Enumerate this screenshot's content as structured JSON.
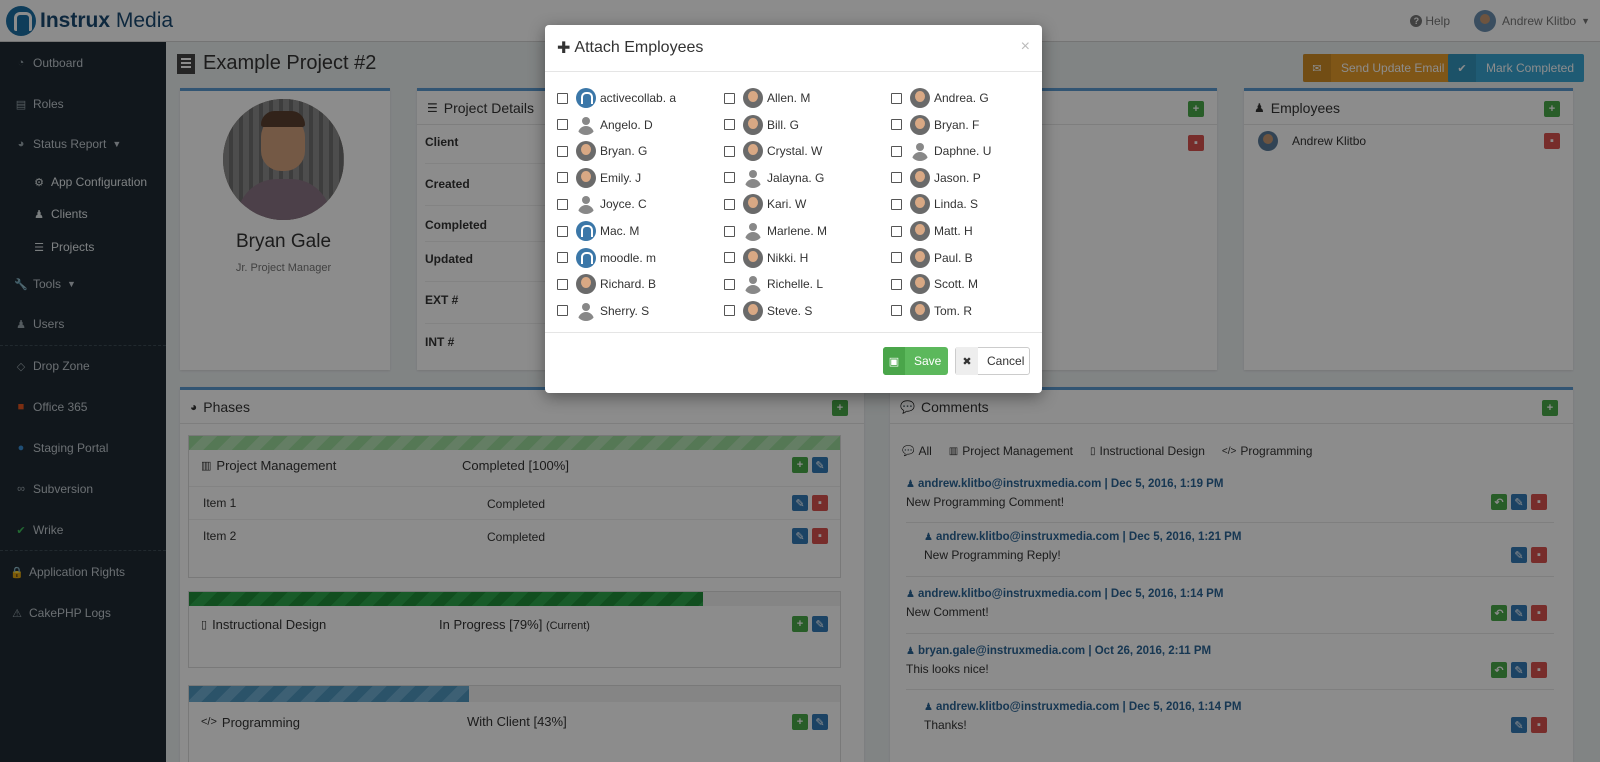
{
  "brand": {
    "name_bold": "Instrux",
    "name_light": " Media"
  },
  "topbar": {
    "help": "Help",
    "user": "Andrew Klitbo"
  },
  "sidebar": {
    "items": [
      {
        "label": "Outboard",
        "icon": "dashboard-icon"
      },
      {
        "label": "Roles",
        "icon": "id-card-icon"
      },
      {
        "label": "Status Report",
        "icon": "pie-chart-icon"
      },
      {
        "label": "App Configuration",
        "icon": "cogs-icon"
      },
      {
        "label": "Clients",
        "icon": "users-icon"
      },
      {
        "label": "Projects",
        "icon": "list-icon"
      },
      {
        "label": "Tools",
        "icon": "wrench-icon"
      },
      {
        "label": "Users",
        "icon": "users-icon"
      },
      {
        "label": "Drop Zone",
        "icon": "dropbox-icon"
      },
      {
        "label": "Office 365",
        "icon": "office-icon"
      },
      {
        "label": "Staging Portal",
        "icon": "drop-icon"
      },
      {
        "label": "Subversion",
        "icon": "link-icon"
      },
      {
        "label": "Wrike",
        "icon": "check-icon"
      },
      {
        "label": "Application Rights",
        "icon": "lock-icon"
      },
      {
        "label": "CakePHP Logs",
        "icon": "warning-icon"
      }
    ]
  },
  "page": {
    "title": "Example Project #2",
    "send_update": "Send Update Email",
    "mark_completed": "Mark Completed"
  },
  "profile": {
    "name": "Bryan Gale",
    "role": "Jr. Project Manager"
  },
  "details": {
    "title": "Project Details",
    "rows": [
      "Client",
      "Created",
      "Completed",
      "Updated",
      "EXT #",
      "INT #"
    ]
  },
  "employees_panel": {
    "title": "Employees",
    "name": "Andrew Klitbo"
  },
  "phases": {
    "title": "Phases",
    "items": [
      {
        "name": "Project Management",
        "status": "Completed [100%]",
        "current": "",
        "rows": [
          {
            "name": "Item 1",
            "status": "Completed"
          },
          {
            "name": "Item 2",
            "status": "Completed"
          }
        ]
      },
      {
        "name": "Instructional Design",
        "status": "In Progress [79%]",
        "current": "(Current)"
      },
      {
        "name": "Programming",
        "status": "With Client [43%]",
        "current": ""
      }
    ]
  },
  "comments": {
    "title": "Comments",
    "tabs": [
      "All",
      "Project Management",
      "Instructional Design",
      "Programming"
    ],
    "items": [
      {
        "author": "andrew.klitbo@instruxmedia.com | Dec 5, 2016, 1:19 PM",
        "text": "New Programming Comment!"
      },
      {
        "author": "andrew.klitbo@instruxmedia.com | Dec 5, 2016, 1:21 PM",
        "text": "New Programming Reply!"
      },
      {
        "author": "andrew.klitbo@instruxmedia.com | Dec 5, 2016, 1:14 PM",
        "text": "New Comment!"
      },
      {
        "author": "bryan.gale@instruxmedia.com | Oct 26, 2016, 2:11 PM",
        "text": "This looks nice!"
      },
      {
        "author": "andrew.klitbo@instruxmedia.com | Dec 5, 2016, 1:14 PM",
        "text": "Thanks!"
      }
    ]
  },
  "modal": {
    "title": "Attach Employees",
    "close": "×",
    "save": "Save",
    "cancel": "Cancel",
    "employees": [
      {
        "name": "activecollab. a",
        "avatar": "logo"
      },
      {
        "name": "Allen. M",
        "avatar": "photo"
      },
      {
        "name": "Andrea. G",
        "avatar": "photo"
      },
      {
        "name": "Angelo. D",
        "avatar": "generic"
      },
      {
        "name": "Bill. G",
        "avatar": "photo"
      },
      {
        "name": "Bryan. F",
        "avatar": "photo"
      },
      {
        "name": "Bryan. G",
        "avatar": "photo"
      },
      {
        "name": "Crystal. W",
        "avatar": "photo"
      },
      {
        "name": "Daphne. U",
        "avatar": "generic"
      },
      {
        "name": "Emily. J",
        "avatar": "photo"
      },
      {
        "name": "Jalayna. G",
        "avatar": "generic"
      },
      {
        "name": "Jason. P",
        "avatar": "photo"
      },
      {
        "name": "Joyce. C",
        "avatar": "generic"
      },
      {
        "name": "Kari. W",
        "avatar": "photo"
      },
      {
        "name": "Linda. S",
        "avatar": "photo"
      },
      {
        "name": "Mac. M",
        "avatar": "logo"
      },
      {
        "name": "Marlene. M",
        "avatar": "generic"
      },
      {
        "name": "Matt. H",
        "avatar": "photo"
      },
      {
        "name": "moodle. m",
        "avatar": "logo"
      },
      {
        "name": "Nikki. H",
        "avatar": "photo"
      },
      {
        "name": "Paul. B",
        "avatar": "photo"
      },
      {
        "name": "Richard. B",
        "avatar": "photo"
      },
      {
        "name": "Richelle. L",
        "avatar": "generic"
      },
      {
        "name": "Scott. M",
        "avatar": "photo"
      },
      {
        "name": "Sherry. S",
        "avatar": "generic"
      },
      {
        "name": "Steve. S",
        "avatar": "photo"
      },
      {
        "name": "Tom. R",
        "avatar": "photo"
      }
    ]
  }
}
